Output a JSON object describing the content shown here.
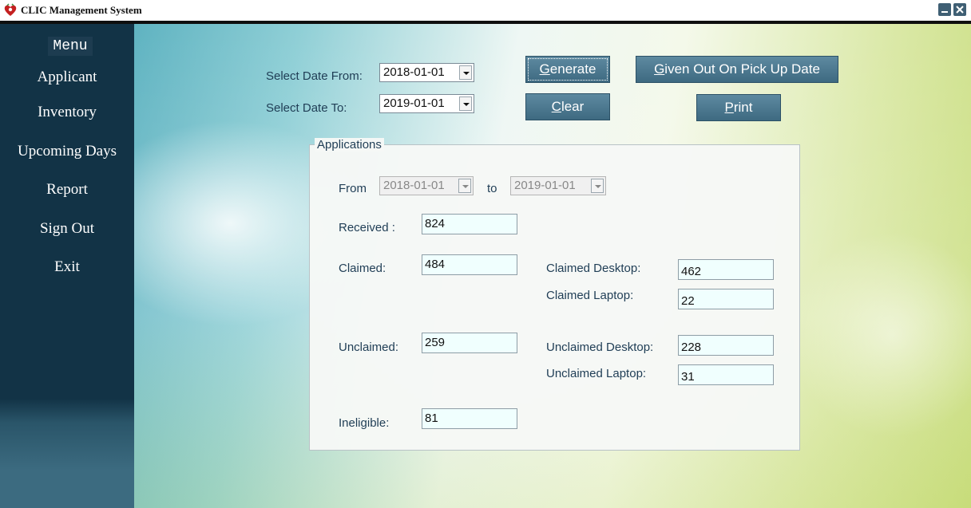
{
  "window": {
    "title": "CLIC Management System",
    "icons": {
      "app": "app-logo-icon",
      "minimize": "minimize-icon",
      "close": "close-icon"
    }
  },
  "sidebar": {
    "heading": "Menu",
    "items": [
      "Applicant",
      "Inventory",
      "Upcoming Days",
      "Report",
      "Sign Out",
      "Exit"
    ]
  },
  "filters": {
    "date_from_label": "Select Date From:",
    "date_from_value": "2018-01-01",
    "date_to_label": "Select Date To:",
    "date_to_value": "2019-01-01"
  },
  "buttons": {
    "generate": {
      "mnemonic": "G",
      "rest": "enerate"
    },
    "clear": {
      "mnemonic": "C",
      "rest": "lear"
    },
    "given_out": {
      "mnemonic": "G",
      "rest": "iven Out On Pick Up Date"
    },
    "print": {
      "mnemonic": "P",
      "rest": "rint"
    }
  },
  "applications": {
    "title": "Applications",
    "from_label": "From",
    "from_value": "2018-01-01",
    "to_label": "to",
    "to_value": "2019-01-01",
    "received_label": "Received :",
    "received_value": "824",
    "claimed_label": "Claimed:",
    "claimed_value": "484",
    "claimed_desktop_label": "Claimed Desktop:",
    "claimed_desktop_value": "462",
    "claimed_laptop_label": "Claimed Laptop:",
    "claimed_laptop_value": "22",
    "unclaimed_label": "Unclaimed:",
    "unclaimed_value": "259",
    "unclaimed_desktop_label": "Unclaimed Desktop:",
    "unclaimed_desktop_value": "228",
    "unclaimed_laptop_label": "Unclaimed Laptop:",
    "unclaimed_laptop_value": "31",
    "ineligible_label": "Ineligible:",
    "ineligible_value": "81"
  },
  "colors": {
    "sidebar_bg": "#123346",
    "button_bg": "#3e6a81",
    "label_text": "#1f3d55",
    "field_bg": "#f0fffe"
  }
}
